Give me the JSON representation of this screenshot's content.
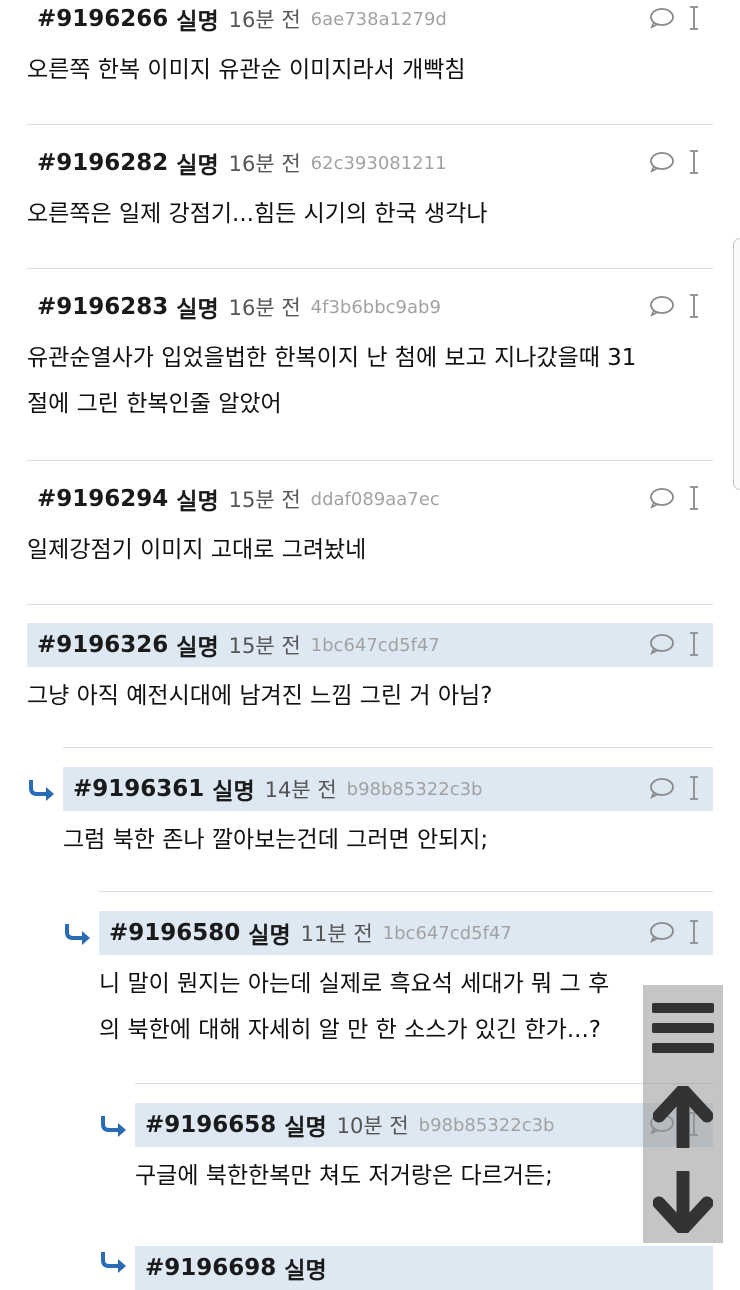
{
  "comments": [
    {
      "num": "#9196266",
      "author": "실명",
      "time": "16분 전",
      "hash": "6ae738a1279d",
      "text": [
        "오른쪽 한복 이미지 유관순 이미지라서 개빡침"
      ]
    },
    {
      "num": "#9196282",
      "author": "실명",
      "time": "16분 전",
      "hash": "62c393081211",
      "text": [
        "오른쪽은 일제 강점기...힘든 시기의 한국 생각나"
      ]
    },
    {
      "num": "#9196283",
      "author": "실명",
      "time": "16분 전",
      "hash": "4f3b6bbc9ab9",
      "text": [
        "유관순열사가 입었을법한 한복이지 난 첨에 보고 지나갔을때 31",
        "절에 그린 한복인줄 알았어"
      ]
    },
    {
      "num": "#9196294",
      "author": "실명",
      "time": "15분 전",
      "hash": "ddaf089aa7ec",
      "text": [
        "일제강점기 이미지 고대로 그려놨네"
      ]
    },
    {
      "num": "#9196326",
      "author": "실명",
      "time": "15분 전",
      "hash": "1bc647cd5f47",
      "text": [
        "그냥 아직 예전시대에 남겨진 느낌 그린 거 아님?"
      ]
    },
    {
      "num": "#9196361",
      "author": "실명",
      "time": "14분 전",
      "hash": "b98b85322c3b",
      "text": [
        "그럼 북한 존나 깔아보는건데 그러면 안되지;"
      ]
    },
    {
      "num": "#9196580",
      "author": "실명",
      "time": "11분 전",
      "hash": "1bc647cd5f47",
      "text": [
        "니 말이 뭔지는 아는데 실제로 흑요석 세대가 뭐 그 후",
        "의 북한에 대해 자세히 알 만 한 소스가 있긴 한가...?"
      ]
    },
    {
      "num": "#9196658",
      "author": "실명",
      "time": "10분 전",
      "hash": "b98b85322c3b",
      "text": [
        "구글에 북한한복만 쳐도 저거랑은 다르거든;"
      ]
    },
    {
      "num": "#9196698",
      "author": "실명",
      "time": "",
      "hash": "",
      "text": []
    }
  ],
  "colors": {
    "highlight": "#dde8f3",
    "reply_arrow": "#2a6bb5",
    "separator": "#dcdcdc"
  },
  "icons": {
    "comment": "speech-bubble-icon",
    "cursor": "text-cursor-icon",
    "reply": "reply-arrow-icon",
    "menu": "hamburger-menu-icon",
    "up": "arrow-up-icon",
    "down": "arrow-down-icon"
  }
}
